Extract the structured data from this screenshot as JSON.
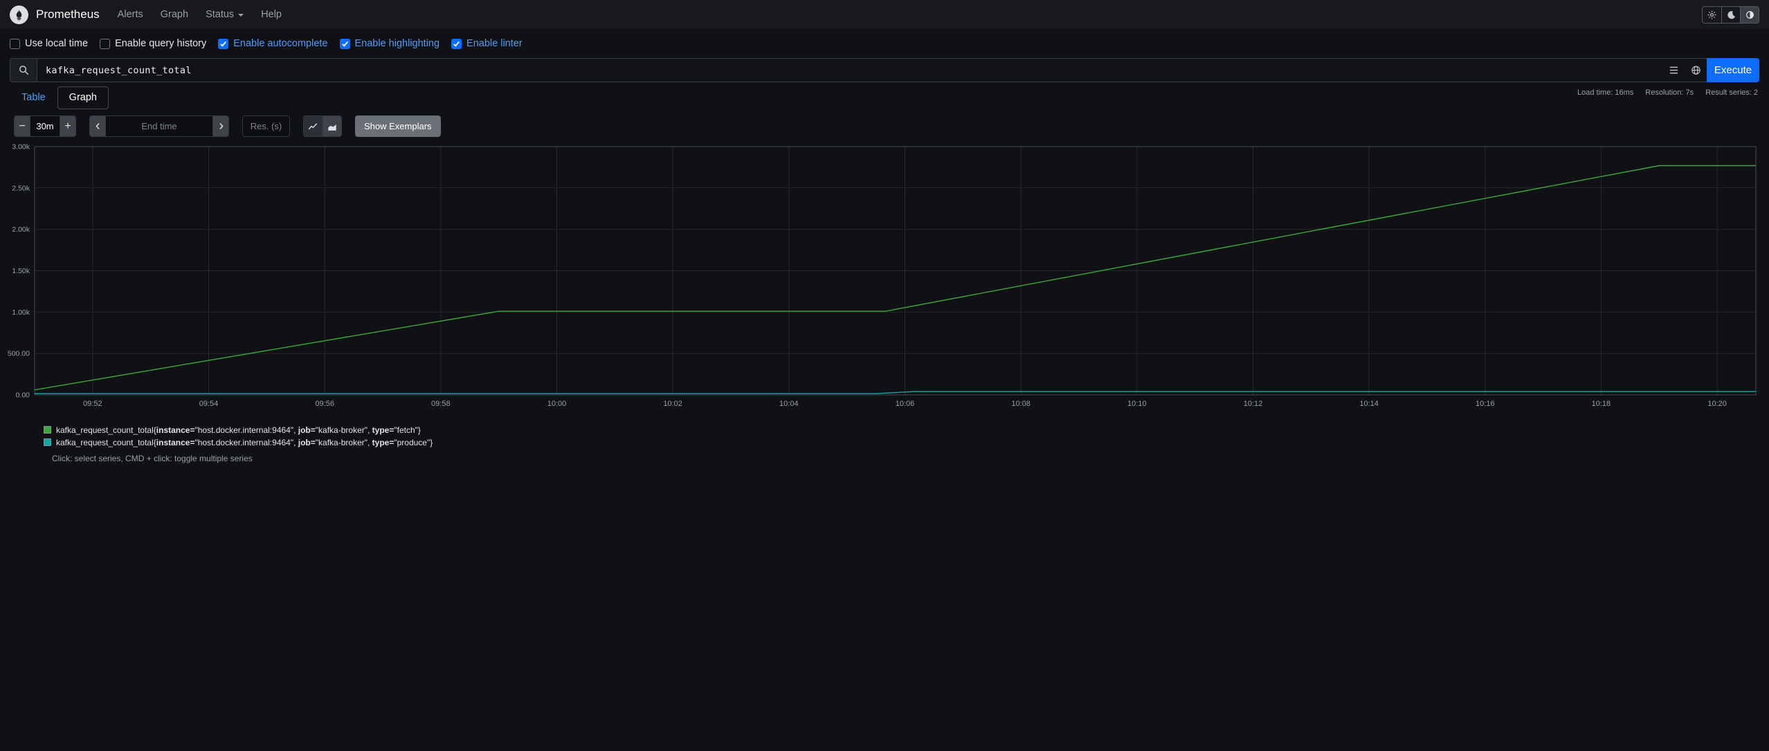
{
  "colors": {
    "accent_blue": "#0d6efd",
    "link_blue": "#4f9cf9",
    "series_fetch_green": "#3ca83c",
    "series_produce_teal": "#13a8a8",
    "navbar_bg": "#17191d",
    "page_bg": "#0f1114"
  },
  "navbar": {
    "brand": "Prometheus",
    "items": [
      {
        "label": "Alerts",
        "caret": false
      },
      {
        "label": "Graph",
        "caret": false
      },
      {
        "label": "Status",
        "caret": true
      },
      {
        "label": "Help",
        "caret": false
      }
    ]
  },
  "options": [
    {
      "label": "Use local time",
      "checked": false
    },
    {
      "label": "Enable query history",
      "checked": false
    },
    {
      "label": "Enable autocomplete",
      "checked": true
    },
    {
      "label": "Enable highlighting",
      "checked": true
    },
    {
      "label": "Enable linter",
      "checked": true
    }
  ],
  "query": {
    "value": "kafka_request_count_total",
    "execute_label": "Execute"
  },
  "stats": {
    "load_time": "Load time: 16ms",
    "resolution": "Resolution: 7s",
    "result_series": "Result series: 2"
  },
  "tabs": [
    {
      "label": "Table",
      "active": false
    },
    {
      "label": "Graph",
      "active": true
    }
  ],
  "controls": {
    "decrease_label": "−",
    "range_value": "30m",
    "increase_label": "+",
    "end_time_placeholder": "End time",
    "resolution_placeholder": "Res. (s)",
    "show_exemplars_label": "Show Exemplars"
  },
  "chart_data": {
    "type": "line",
    "title": "",
    "xlabel": "",
    "ylabel": "",
    "x_domain": [
      "09:51:00",
      "10:20:40"
    ],
    "y_domain": [
      0,
      3000
    ],
    "grid": true,
    "legend_position": "bottom",
    "x_ticks": [
      "09:52",
      "09:54",
      "09:56",
      "09:58",
      "10:00",
      "10:02",
      "10:04",
      "10:06",
      "10:08",
      "10:10",
      "10:12",
      "10:14",
      "10:16",
      "10:18",
      "10:20"
    ],
    "y_ticks": [
      {
        "value": 0,
        "label": "0.00"
      },
      {
        "value": 500,
        "label": "500.00"
      },
      {
        "value": 1000,
        "label": "1.00k"
      },
      {
        "value": 1500,
        "label": "1.50k"
      },
      {
        "value": 2000,
        "label": "2.00k"
      },
      {
        "value": 2500,
        "label": "2.50k"
      },
      {
        "value": 3000,
        "label": "3.00k"
      }
    ],
    "series": [
      {
        "name": "kafka_request_count_total{instance=\"host.docker.internal:9464\", job=\"kafka-broker\", type=\"fetch\"}",
        "color": "#3ca83c",
        "points": [
          [
            "09:51:00",
            60
          ],
          [
            "09:59:00",
            1010
          ],
          [
            "10:05:40",
            1010
          ],
          [
            "10:19:00",
            2770
          ],
          [
            "10:20:40",
            2770
          ]
        ]
      },
      {
        "name": "kafka_request_count_total{instance=\"host.docker.internal:9464\", job=\"kafka-broker\", type=\"produce\"}",
        "color": "#13a8a8",
        "points": [
          [
            "09:51:00",
            15
          ],
          [
            "10:05:30",
            15
          ],
          [
            "10:06:10",
            40
          ],
          [
            "10:20:40",
            40
          ]
        ]
      }
    ]
  },
  "legend": {
    "series": [
      {
        "color": "#3ca83c",
        "metric": "kafka_request_count_total",
        "labels": [
          {
            "name": "instance",
            "value": "host.docker.internal:9464"
          },
          {
            "name": "job",
            "value": "kafka-broker"
          },
          {
            "name": "type",
            "value": "fetch"
          }
        ]
      },
      {
        "color": "#13a8a8",
        "metric": "kafka_request_count_total",
        "labels": [
          {
            "name": "instance",
            "value": "host.docker.internal:9464"
          },
          {
            "name": "job",
            "value": "kafka-broker"
          },
          {
            "name": "type",
            "value": "produce"
          }
        ]
      }
    ],
    "hint": "Click: select series, CMD + click: toggle multiple series"
  }
}
